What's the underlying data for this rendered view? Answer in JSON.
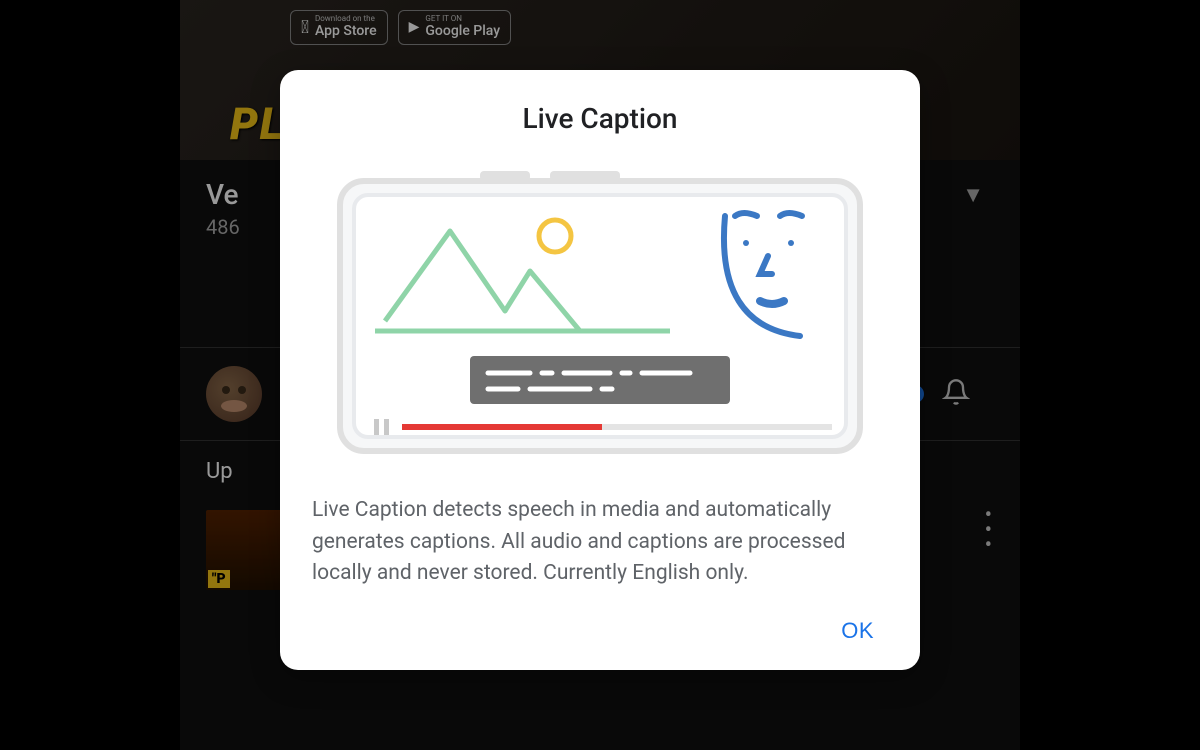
{
  "banner": {
    "app_store_small": "Download on the",
    "app_store_big": "App Store",
    "google_play_small": "GET IT ON",
    "google_play_big": "Google Play",
    "promo_text": "PLAY FOR FREE"
  },
  "video": {
    "title_visible": "Ve",
    "views_visible": "486"
  },
  "up_next_label": "Up",
  "thumb_tag": "\"P",
  "dialog": {
    "title": "Live Caption",
    "description": "Live Caption detects speech in media and automatically generates captions. All audio and captions are processed locally and never stored. Currently English only.",
    "ok_label": "OK"
  }
}
